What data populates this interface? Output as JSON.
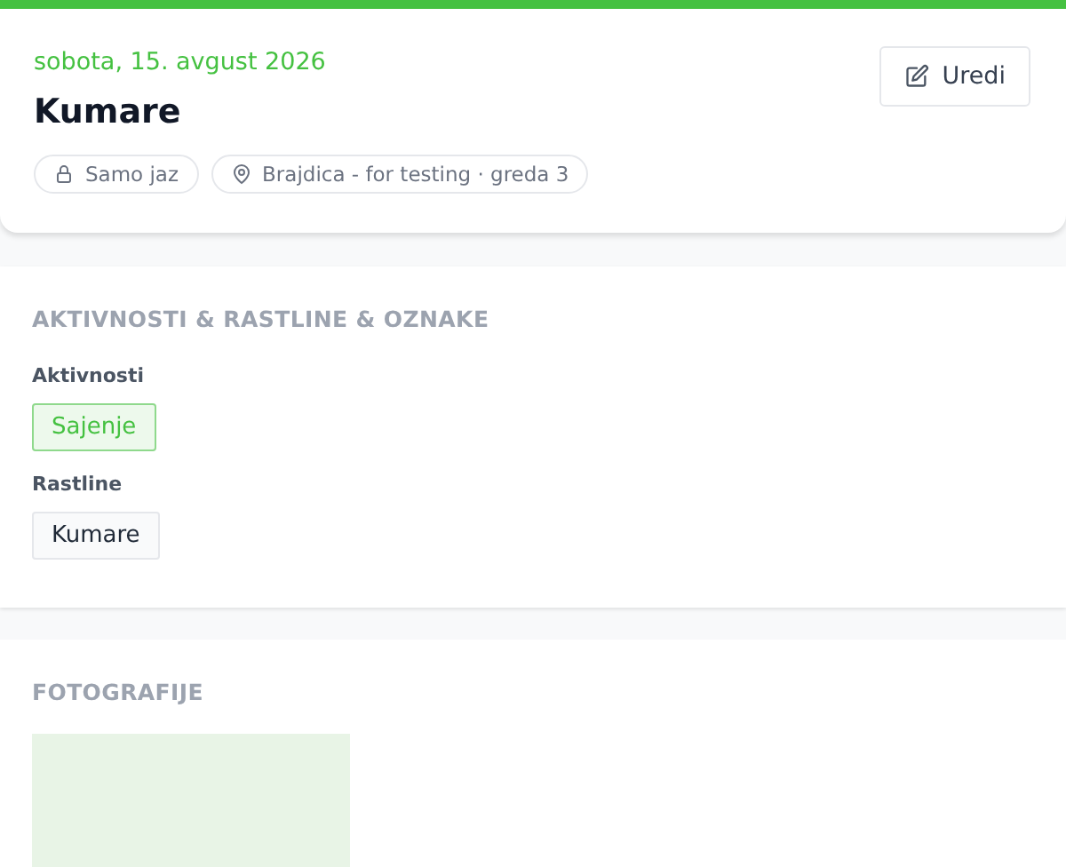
{
  "header": {
    "date": "sobota, 15. avgust 2026",
    "title": "Kumare",
    "edit_button": "Uredi",
    "chips": [
      {
        "kind": "privacy",
        "label": "Samo jaz"
      },
      {
        "kind": "location",
        "label": "Brajdica - for testing · greda 3"
      }
    ]
  },
  "details": {
    "heading": "AKTIVNOSTI & RASTLINE & OZNAKE",
    "groups": [
      {
        "label": "Aktivnosti",
        "kind": "activity",
        "tags": [
          "Sajenje"
        ]
      },
      {
        "label": "Rastline",
        "kind": "plant",
        "tags": [
          "Kumare"
        ]
      }
    ]
  },
  "photos": {
    "heading": "FOTOGRAFIJE",
    "items": [
      {
        "kind": "placeholder"
      }
    ]
  }
}
